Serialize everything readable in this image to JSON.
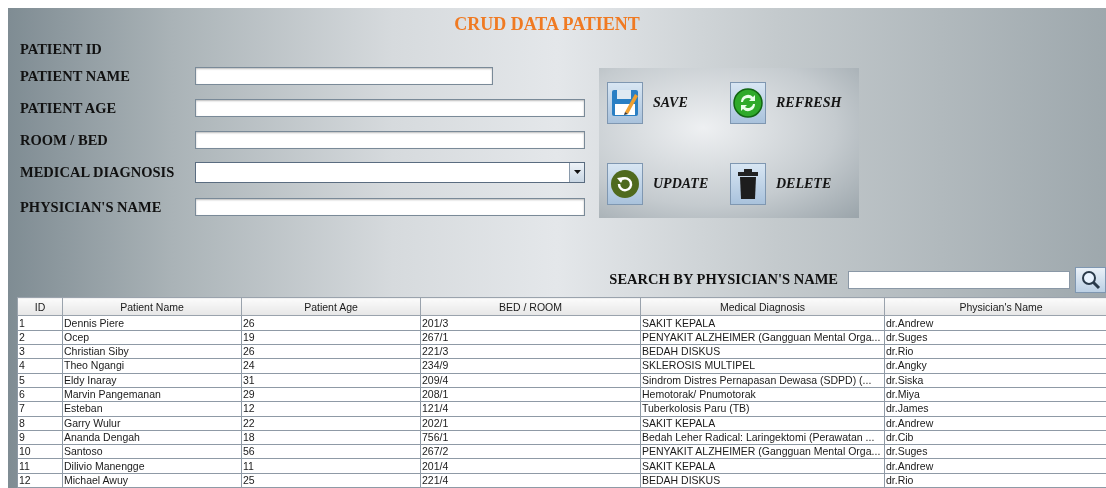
{
  "title": "CRUD DATA PATIENT",
  "form": {
    "fields": [
      {
        "label": "PATIENT ID",
        "kind": "none"
      },
      {
        "label": "PATIENT NAME",
        "kind": "short"
      },
      {
        "label": "PATIENT AGE",
        "kind": "text"
      },
      {
        "label": "ROOM / BED",
        "kind": "text"
      },
      {
        "label": "MEDICAL DIAGNOSIS",
        "kind": "dropdown"
      },
      {
        "label": "PHYSICIAN'S NAME",
        "kind": "text"
      }
    ]
  },
  "buttons": [
    {
      "label": "SAVE",
      "kind": "save"
    },
    {
      "label": "REFRESH",
      "kind": "refresh"
    },
    {
      "label": "UPDATE",
      "kind": "update"
    },
    {
      "label": "DELETE",
      "kind": "delete"
    }
  ],
  "search": {
    "label": "SEARCH BY PHYSICIAN'S NAME"
  },
  "table": {
    "columns": [
      "ID",
      "Patient Name",
      "Patient Age",
      "BED / ROOM",
      "Medical Diagnosis",
      "Physician's Name"
    ],
    "rows": [
      [
        "1",
        "Dennis Piere",
        "26",
        "201/3",
        "SAKIT KEPALA",
        "dr.Andrew"
      ],
      [
        "2",
        "Ocep",
        "19",
        "267/1",
        "PENYAKIT ALZHEIMER (Gangguan Mental Orga...",
        "dr.Suges"
      ],
      [
        "3",
        "Christian Siby",
        "26",
        "221/3",
        "BEDAH DISKUS",
        "dr.Rio"
      ],
      [
        "4",
        "Theo Ngangi",
        "24",
        "234/9",
        "SKLEROSIS MULTIPEL",
        "dr.Angky"
      ],
      [
        "5",
        "Eldy Inaray",
        "31",
        "209/4",
        "Sindrom Distres Pernapasan Dewasa (SDPD) (...",
        "dr.Siska"
      ],
      [
        "6",
        "Marvin Pangemanan",
        "29",
        "208/1",
        "Hemotorak/ Pnumotorak",
        "dr.Miya"
      ],
      [
        "7",
        "Esteban",
        "12",
        "121/4",
        "Tuberkolosis Paru (TB)",
        "dr.James"
      ],
      [
        "8",
        "Garry Wulur",
        "22",
        "202/1",
        "SAKIT KEPALA",
        "dr.Andrew"
      ],
      [
        "9",
        "Ananda Dengah",
        "18",
        "756/1",
        "Bedah Leher Radical: Laringektomi (Perawatan ...",
        "dr.Cib"
      ],
      [
        "10",
        "Santoso",
        "56",
        "267/2",
        "PENYAKIT ALZHEIMER (Gangguan Mental Orga...",
        "dr.Suges"
      ],
      [
        "11",
        "Dilivio Manengge",
        "11",
        "201/4",
        "SAKIT KEPALA",
        "dr.Andrew"
      ],
      [
        "12",
        "Michael Awuy",
        "25",
        "221/4",
        "BEDAH DISKUS",
        "dr.Rio"
      ]
    ]
  }
}
